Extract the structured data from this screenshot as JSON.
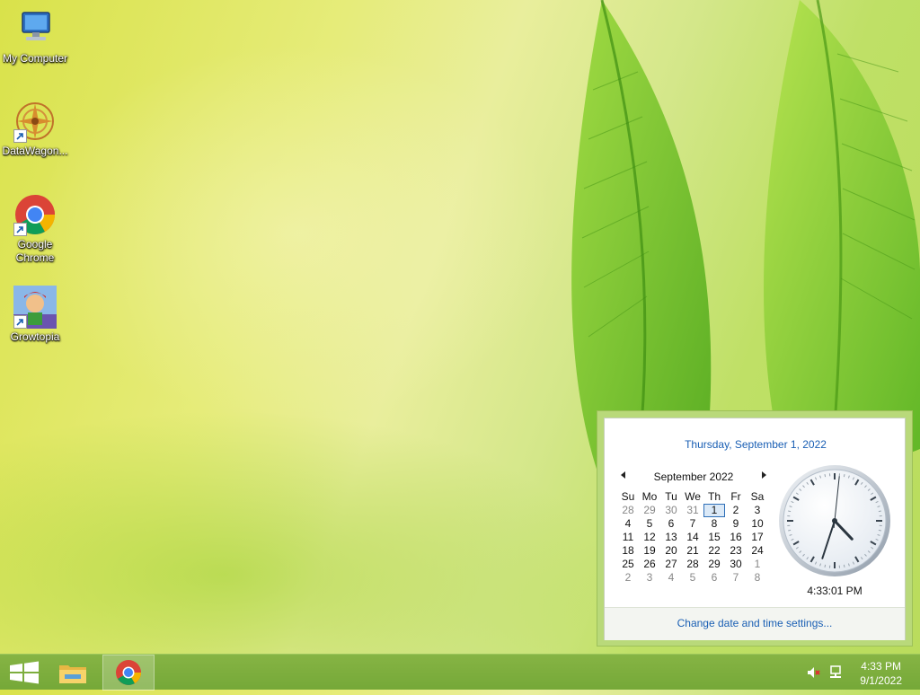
{
  "desktop": {
    "icons": [
      {
        "label": "My Computer",
        "icon": "computer-icon"
      },
      {
        "label": "DataWagon...",
        "icon": "datawagon-icon"
      },
      {
        "label": "Google Chrome",
        "icon": "chrome-icon"
      },
      {
        "label": "Growtopia",
        "icon": "growtopia-icon"
      }
    ]
  },
  "flyout": {
    "long_date": "Thursday, September 1, 2022",
    "month_title": "September 2022",
    "weekdays": [
      "Su",
      "Mo",
      "Tu",
      "We",
      "Th",
      "Fr",
      "Sa"
    ],
    "weeks": [
      [
        "28",
        "29",
        "30",
        "31",
        "1",
        "2",
        "3"
      ],
      [
        "4",
        "5",
        "6",
        "7",
        "8",
        "9",
        "10"
      ],
      [
        "11",
        "12",
        "13",
        "14",
        "15",
        "16",
        "17"
      ],
      [
        "18",
        "19",
        "20",
        "21",
        "22",
        "23",
        "24"
      ],
      [
        "25",
        "26",
        "27",
        "28",
        "29",
        "30",
        "1"
      ],
      [
        "2",
        "3",
        "4",
        "5",
        "6",
        "7",
        "8"
      ]
    ],
    "today": "1",
    "clock_time": "4:33:01 PM",
    "clock_hours": 4,
    "clock_minutes": 33,
    "clock_seconds": 1,
    "settings_link": "Change date and time settings..."
  },
  "taskbar": {
    "start_icon": "windows-logo-icon",
    "pinned": [
      {
        "icon": "file-explorer-icon",
        "active": false
      },
      {
        "icon": "chrome-icon",
        "active": true
      }
    ],
    "tray": {
      "volume_icon": "volume-muted-icon",
      "network_icon": "network-icon",
      "time": "4:33 PM",
      "date": "9/1/2022"
    }
  },
  "colors": {
    "accent_link": "#1a5fb4",
    "taskbar": "#7aaf3c"
  }
}
